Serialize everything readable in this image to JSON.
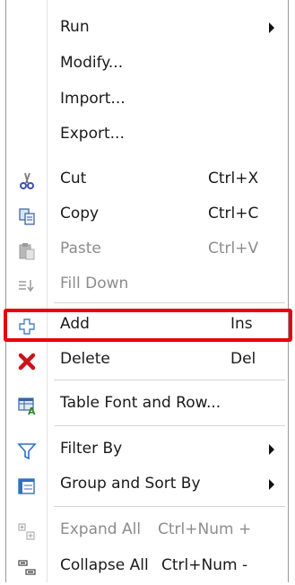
{
  "menu": {
    "items": [
      {
        "id": "run",
        "label": "Run",
        "shortcut": "",
        "icon": "",
        "submenu": true,
        "disabled": false
      },
      {
        "id": "modify",
        "label": "Modify...",
        "shortcut": "",
        "icon": "",
        "submenu": false,
        "disabled": false
      },
      {
        "id": "import",
        "label": "Import...",
        "shortcut": "",
        "icon": "",
        "submenu": false,
        "disabled": false
      },
      {
        "id": "export",
        "label": "Export...",
        "shortcut": "",
        "icon": "",
        "submenu": false,
        "disabled": false
      },
      {
        "id": "cut",
        "label": "Cut",
        "shortcut": "Ctrl+X",
        "icon": "scissors-icon",
        "submenu": false,
        "disabled": false
      },
      {
        "id": "copy",
        "label": "Copy",
        "shortcut": "Ctrl+C",
        "icon": "copy-icon",
        "submenu": false,
        "disabled": false
      },
      {
        "id": "paste",
        "label": "Paste",
        "shortcut": "Ctrl+V",
        "icon": "paste-icon",
        "submenu": false,
        "disabled": true
      },
      {
        "id": "fill_down",
        "label": "Fill Down",
        "shortcut": "",
        "icon": "fill-down-icon",
        "submenu": false,
        "disabled": true
      },
      {
        "id": "add",
        "label": "Add",
        "shortcut": "Ins",
        "icon": "add-icon",
        "submenu": false,
        "disabled": false,
        "highlighted": true
      },
      {
        "id": "delete",
        "label": "Delete",
        "shortcut": "Del",
        "icon": "delete-icon",
        "submenu": false,
        "disabled": false
      },
      {
        "id": "table_font",
        "label": "Table Font and Row...",
        "shortcut": "",
        "icon": "table-font-icon",
        "submenu": false,
        "disabled": false
      },
      {
        "id": "filter_by",
        "label": "Filter By",
        "shortcut": "",
        "icon": "filter-icon",
        "submenu": true,
        "disabled": false
      },
      {
        "id": "group_sort",
        "label": "Group and Sort By",
        "shortcut": "",
        "icon": "group-sort-icon",
        "submenu": true,
        "disabled": false
      },
      {
        "id": "expand_all",
        "label": "Expand All",
        "shortcut": "Ctrl+Num +",
        "icon": "expand-all-icon",
        "submenu": false,
        "disabled": true
      },
      {
        "id": "collapse_all",
        "label": "Collapse All",
        "shortcut": "Ctrl+Num -",
        "icon": "collapse-all-icon",
        "submenu": false,
        "disabled": false
      }
    ]
  },
  "colors": {
    "highlight_border": "#e8000b",
    "disabled_text": "#8c8c8c",
    "text": "#1a1a1a",
    "separator": "#d6d6d6"
  }
}
